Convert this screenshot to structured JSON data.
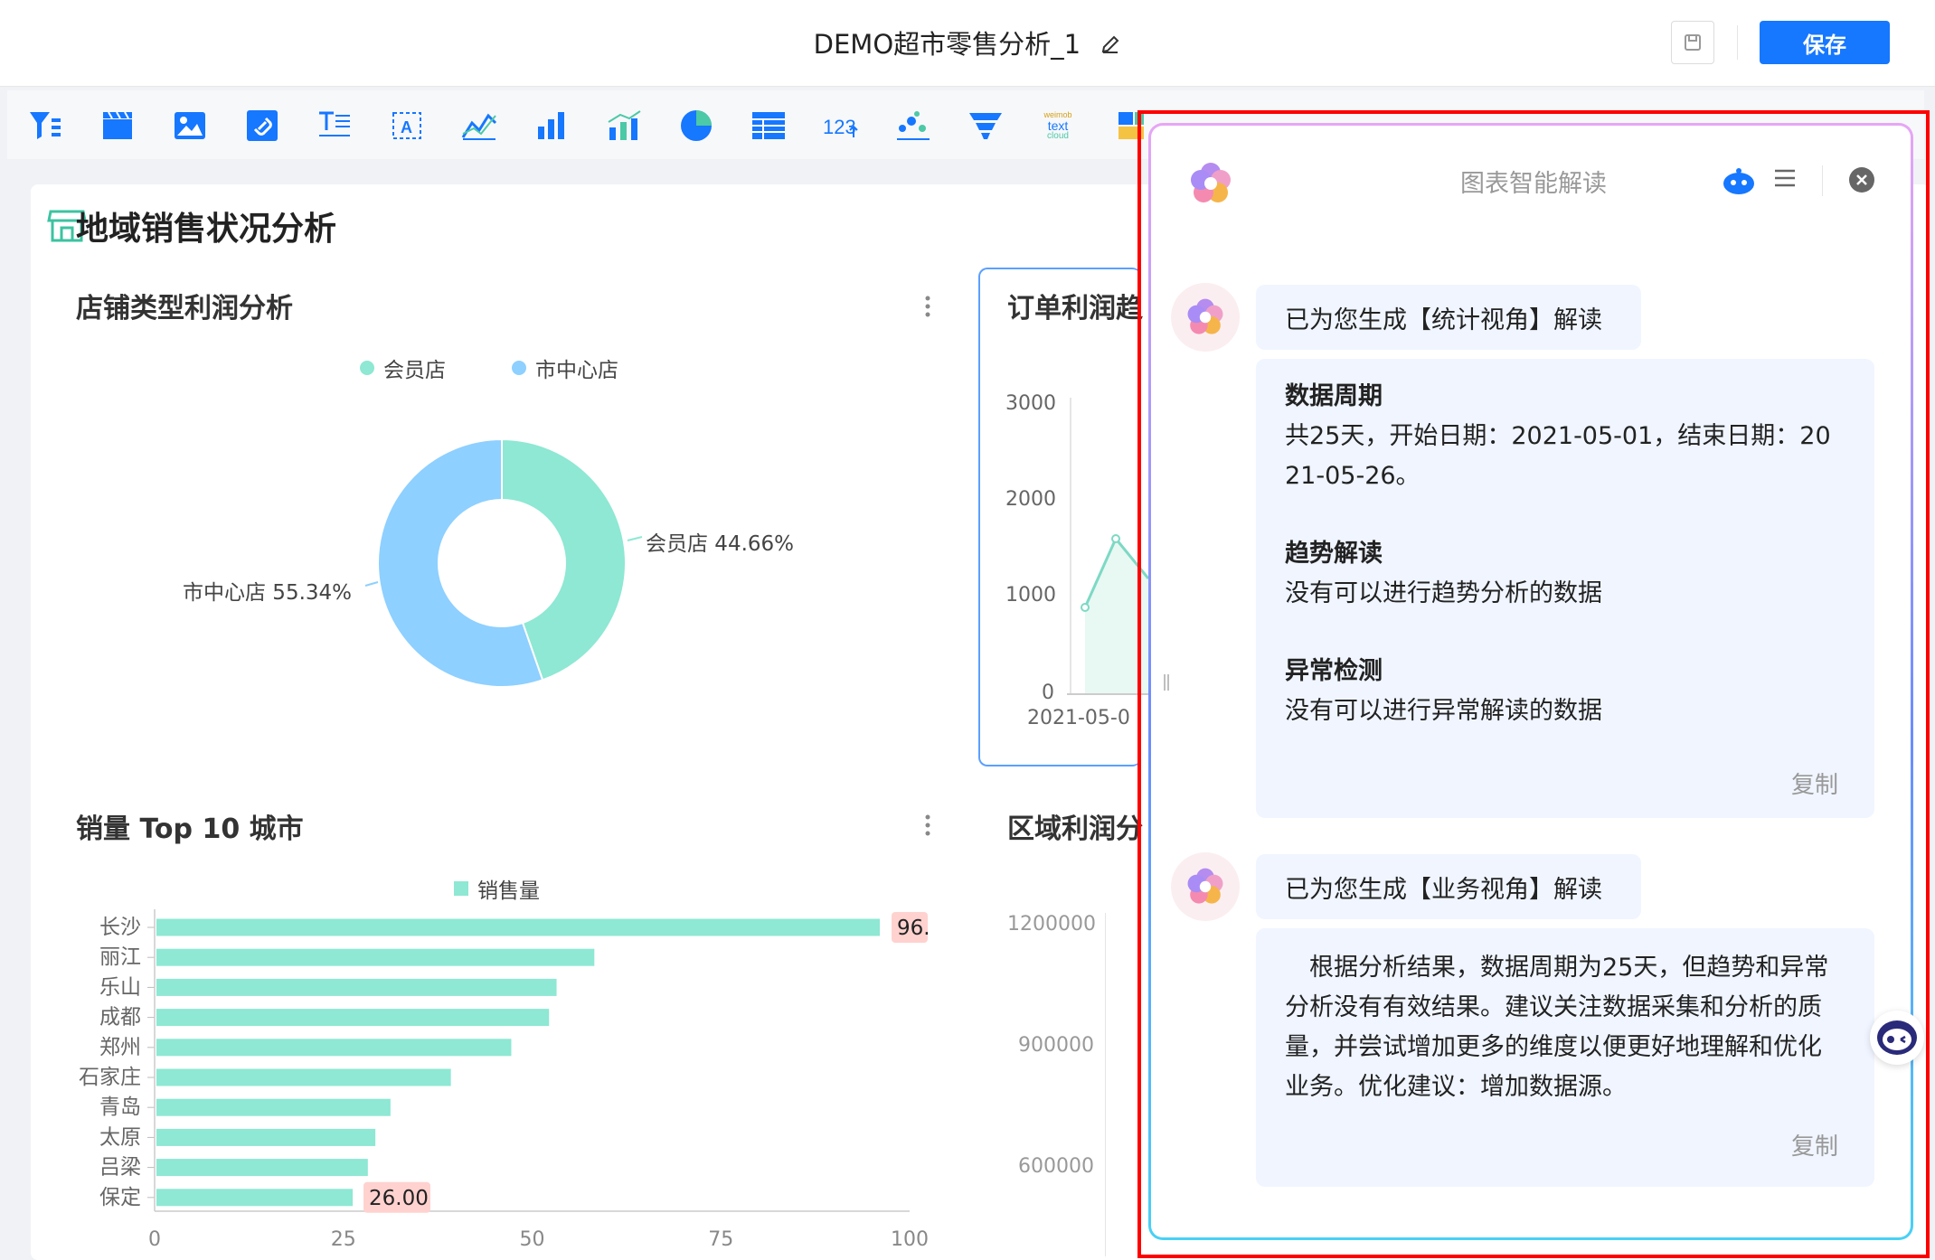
{
  "header": {
    "title": "DEMO超市零售分析_1",
    "save_label": "保存"
  },
  "toolbar": {
    "tools": [
      "filter-icon",
      "clapper-icon",
      "image-icon",
      "link-icon",
      "text-icon",
      "text-box-icon",
      "line-chart-icon",
      "bar-chart-icon",
      "combo-chart-icon",
      "pie-chart-icon",
      "table-icon",
      "number-card-icon",
      "scatter-icon",
      "funnel-icon",
      "word-cloud-icon",
      "treemap-icon"
    ],
    "wordcloud_label": "text",
    "wordcloud_sub": "cloud",
    "wordcloud_top": "weimob",
    "number_card_label": "123"
  },
  "dashboard": {
    "section_title": "地域销售状况分析",
    "colors": {
      "member": "#8ee8d3",
      "center": "#8ed0ff",
      "bar": "#8ee8d3",
      "label_bg": "#ffd2cf",
      "line": "#7dd9c4"
    }
  },
  "pie_chart": {
    "title": "店铺类型利润分析",
    "legend": [
      "会员店",
      "市中心店"
    ],
    "label_member": "会员店  44.66%",
    "label_center": "市中心店  55.34%",
    "more": "⋮"
  },
  "line_chart": {
    "title": "订单利润趋",
    "y_ticks": [
      "3000",
      "2000",
      "1000",
      "0"
    ],
    "x_tick": "2021-05-0"
  },
  "bar_chart": {
    "title": "销量 Top 10 城市",
    "legend": "销售量",
    "value_label_top": "96.",
    "value_label_bottom": "26.00",
    "x_ticks": [
      "0",
      "25",
      "50",
      "75",
      "100"
    ],
    "more": "⋮"
  },
  "region_chart": {
    "title": "区域利润分",
    "y_ticks": [
      "1200000",
      "900000",
      "600000"
    ]
  },
  "chart_data": [
    {
      "type": "pie",
      "title": "店铺类型利润分析",
      "categories": [
        "会员店",
        "市中心店"
      ],
      "values": [
        44.66,
        55.34
      ],
      "unit": "%",
      "legend": "top"
    },
    {
      "type": "bar",
      "orientation": "horizontal",
      "title": "销量 Top 10 城市",
      "categories": [
        "长沙",
        "丽江",
        "乐山",
        "成都",
        "郑州",
        "石家庄",
        "青岛",
        "太原",
        "吕梁",
        "保定"
      ],
      "series": [
        {
          "name": "销售量",
          "values": [
            96,
            58,
            53,
            52,
            47,
            39,
            31,
            29,
            28,
            26
          ]
        }
      ],
      "xlim": [
        0,
        100
      ],
      "legend": "top"
    }
  ],
  "ai_panel": {
    "title": "图表智能解读",
    "stat_head": "已为您生成【统计视角】解读",
    "stat_sections": [
      {
        "heading": "数据周期",
        "text": "共25天，开始日期：2021-05-01，结束日期：20\n21-05-26。"
      },
      {
        "heading": "趋势解读",
        "text": "没有可以进行趋势分析的数据"
      },
      {
        "heading": "异常检测",
        "text": "没有可以进行异常解读的数据"
      }
    ],
    "copy_label": "复制",
    "biz_head": "已为您生成【业务视角】解读",
    "biz_text": "　根据分析结果，数据周期为25天，但趋势和异常分析没有有效结果。建议关注数据采集和分析的质量，并尝试增加更多的维度以便更好地理解和优化业务。优化建议：增加数据源。"
  }
}
